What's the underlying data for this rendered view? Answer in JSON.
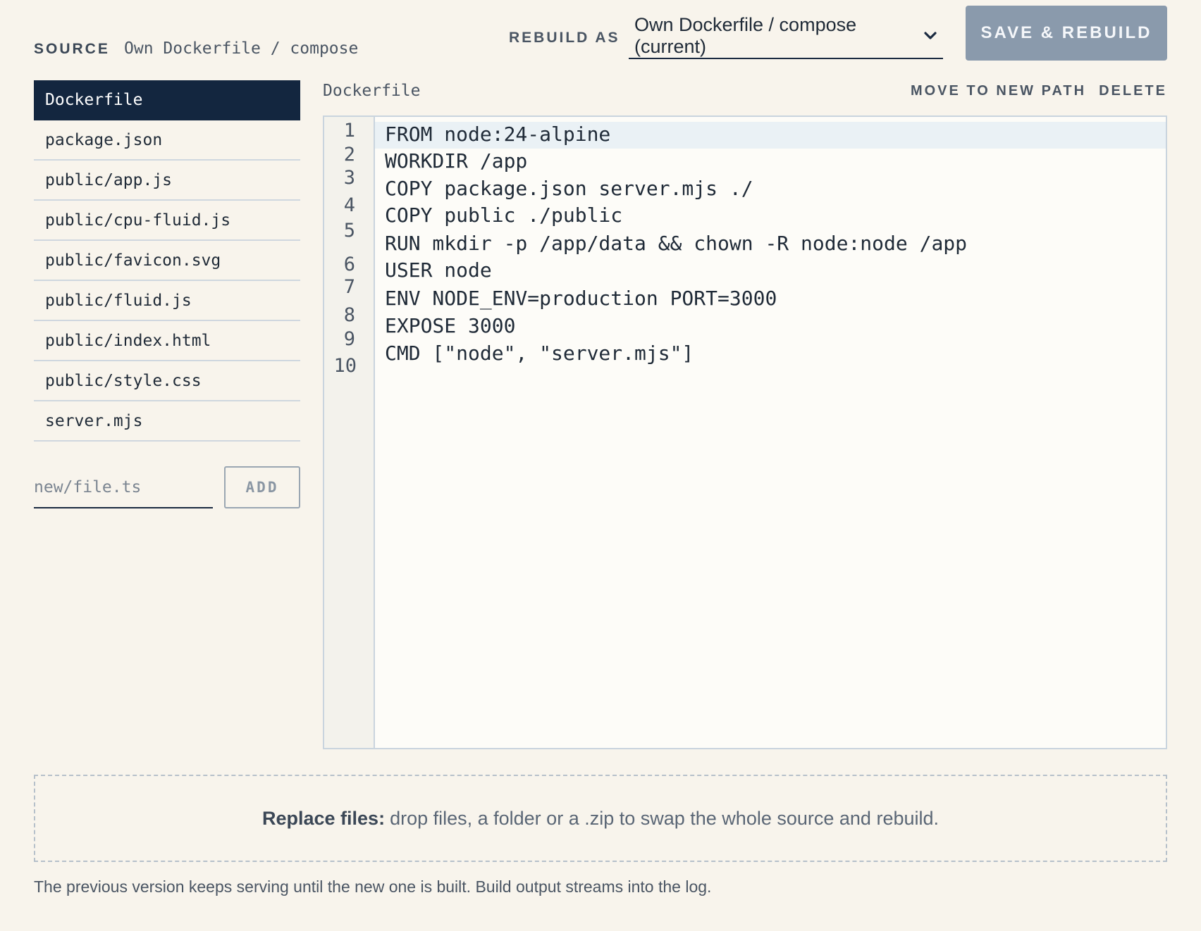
{
  "header": {
    "source_label": "SOURCE",
    "source_value": "Own Dockerfile / compose",
    "rebuild_label": "REBUILD AS",
    "rebuild_selected": "Own Dockerfile / compose (current)",
    "save_label": "SAVE & REBUILD"
  },
  "files": [
    {
      "name": "Dockerfile",
      "active": true
    },
    {
      "name": "package.json"
    },
    {
      "name": "public/app.js"
    },
    {
      "name": "public/cpu-fluid.js"
    },
    {
      "name": "public/favicon.svg"
    },
    {
      "name": "public/fluid.js"
    },
    {
      "name": "public/index.html"
    },
    {
      "name": "public/style.css"
    },
    {
      "name": "server.mjs"
    }
  ],
  "new_file": {
    "placeholder": "new/file.ts",
    "add_label": "ADD"
  },
  "editor": {
    "filename": "Dockerfile",
    "move_label": "MOVE TO NEW PATH",
    "delete_label": "DELETE",
    "line_numbers": [
      "1",
      "2",
      "3",
      "4",
      "5",
      "6",
      "7",
      "8",
      "9",
      "10"
    ],
    "lines": [
      "FROM node:24-alpine",
      "WORKDIR /app",
      "COPY package.json server.mjs ./",
      "COPY public ./public",
      "RUN mkdir -p /app/data && chown -R node:node /app",
      "USER node",
      "ENV NODE_ENV=production PORT=3000",
      "EXPOSE 3000",
      "CMD [\"node\", \"server.mjs\"]"
    ]
  },
  "dropzone": {
    "bold": "Replace files:",
    "text": "drop files, a folder or a .zip to swap the whole source and rebuild."
  },
  "footnote": "The previous version keeps serving until the new one is built. Build output streams into the log."
}
